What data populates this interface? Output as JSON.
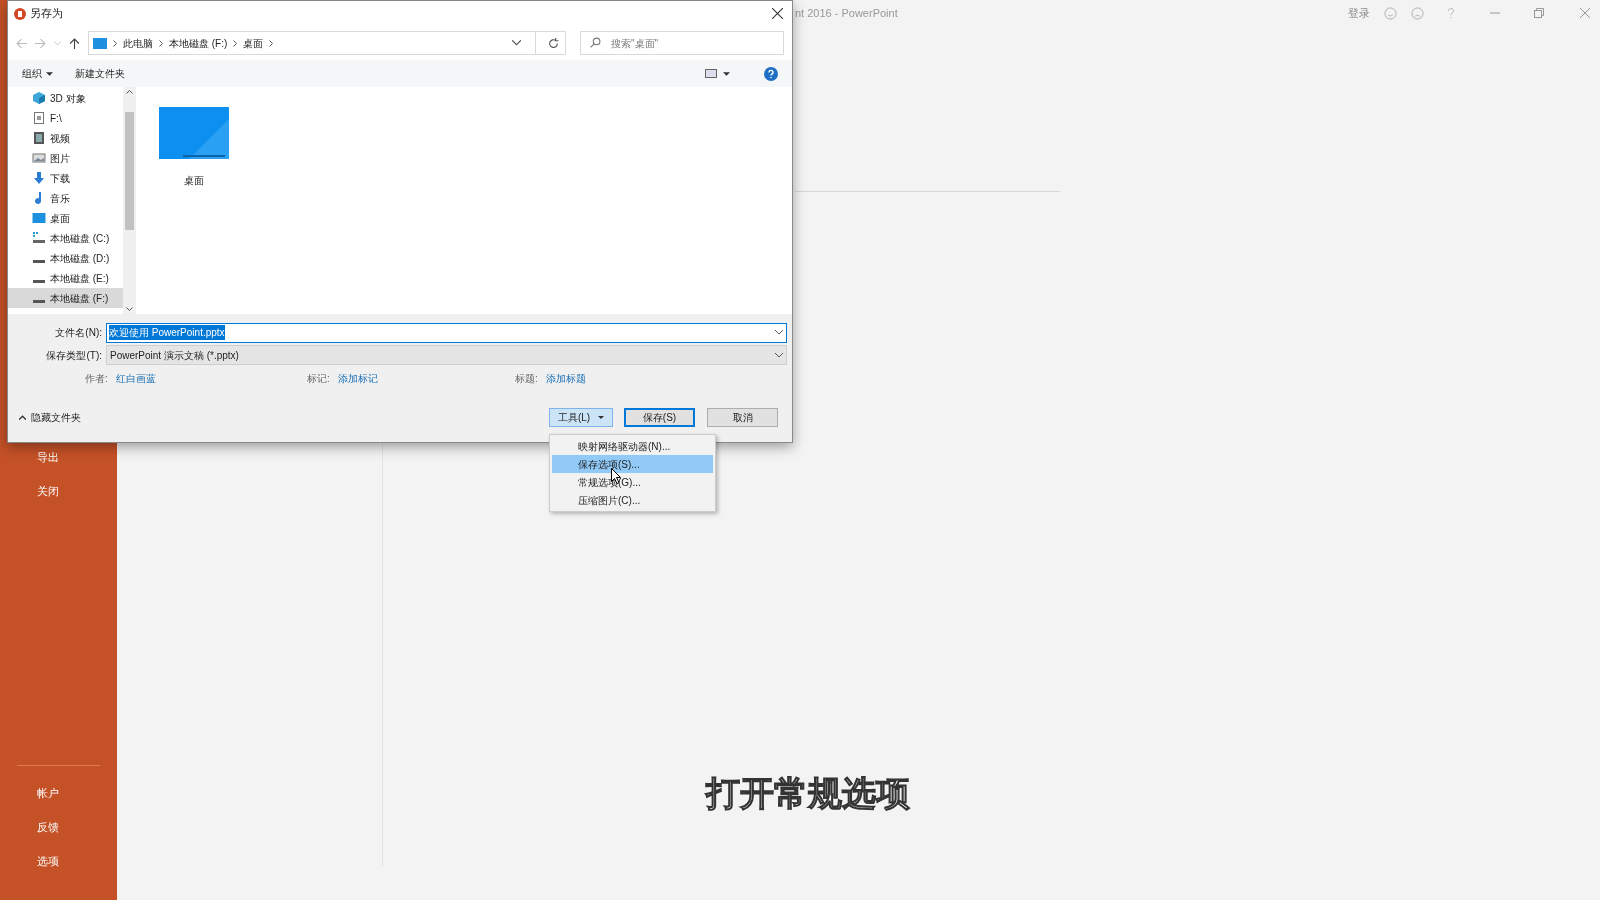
{
  "app": {
    "title": "nt 2016  -  PowerPoint",
    "sign_in": "登录"
  },
  "sidebar": {
    "items": [
      {
        "label": "导出"
      },
      {
        "label": "关闭"
      }
    ],
    "bottom_items": [
      {
        "label": "帐户"
      },
      {
        "label": "反馈"
      },
      {
        "label": "选项"
      }
    ]
  },
  "caption": "打开常规选项",
  "dialog": {
    "title": "另存为",
    "breadcrumb": [
      "此电脑",
      "本地磁盘 (F:)",
      "桌面"
    ],
    "search": {
      "placeholder": "搜索\"桌面\""
    },
    "toolbar": {
      "organize": "组织",
      "new_folder": "新建文件夹"
    },
    "nav_items": [
      {
        "label": "3D 对象",
        "kind": "cube",
        "selected": false
      },
      {
        "label": "F:\\",
        "kind": "file",
        "selected": false
      },
      {
        "label": "视频",
        "kind": "video",
        "selected": false
      },
      {
        "label": "图片",
        "kind": "image",
        "selected": false
      },
      {
        "label": "下载",
        "kind": "download",
        "selected": false
      },
      {
        "label": "音乐",
        "kind": "music",
        "selected": false
      },
      {
        "label": "桌面",
        "kind": "desktop",
        "selected": false
      },
      {
        "label": "本地磁盘 (C:)",
        "kind": "system-drive",
        "selected": false
      },
      {
        "label": "本地磁盘 (D:)",
        "kind": "drive",
        "selected": false
      },
      {
        "label": "本地磁盘 (E:)",
        "kind": "drive",
        "selected": false
      },
      {
        "label": "本地磁盘 (F:)",
        "kind": "drive",
        "selected": true
      }
    ],
    "files": [
      {
        "label": "桌面"
      }
    ],
    "file_name": {
      "label": "文件名(N):",
      "value": "欢迎使用 PowerPoint.pptx"
    },
    "file_type": {
      "label": "保存类型(T):",
      "value": "PowerPoint 演示文稿 (*.pptx)"
    },
    "meta": [
      {
        "label": "作者:",
        "value": "红白画蓝"
      },
      {
        "label": "标记:",
        "value": "添加标记"
      },
      {
        "label": "标题:",
        "value": "添加标题"
      }
    ],
    "hide_folders": "隐藏文件夹",
    "buttons": {
      "tools": "工具(L)",
      "save": "保存(S)",
      "cancel": "取消"
    },
    "tools_menu": [
      {
        "label": "映射网络驱动器(N)...",
        "selected": false
      },
      {
        "label": "保存选项(S)...",
        "selected": true
      },
      {
        "label": "常规选项(G)...",
        "selected": false
      },
      {
        "label": "压缩图片(C)...",
        "selected": false
      }
    ]
  }
}
